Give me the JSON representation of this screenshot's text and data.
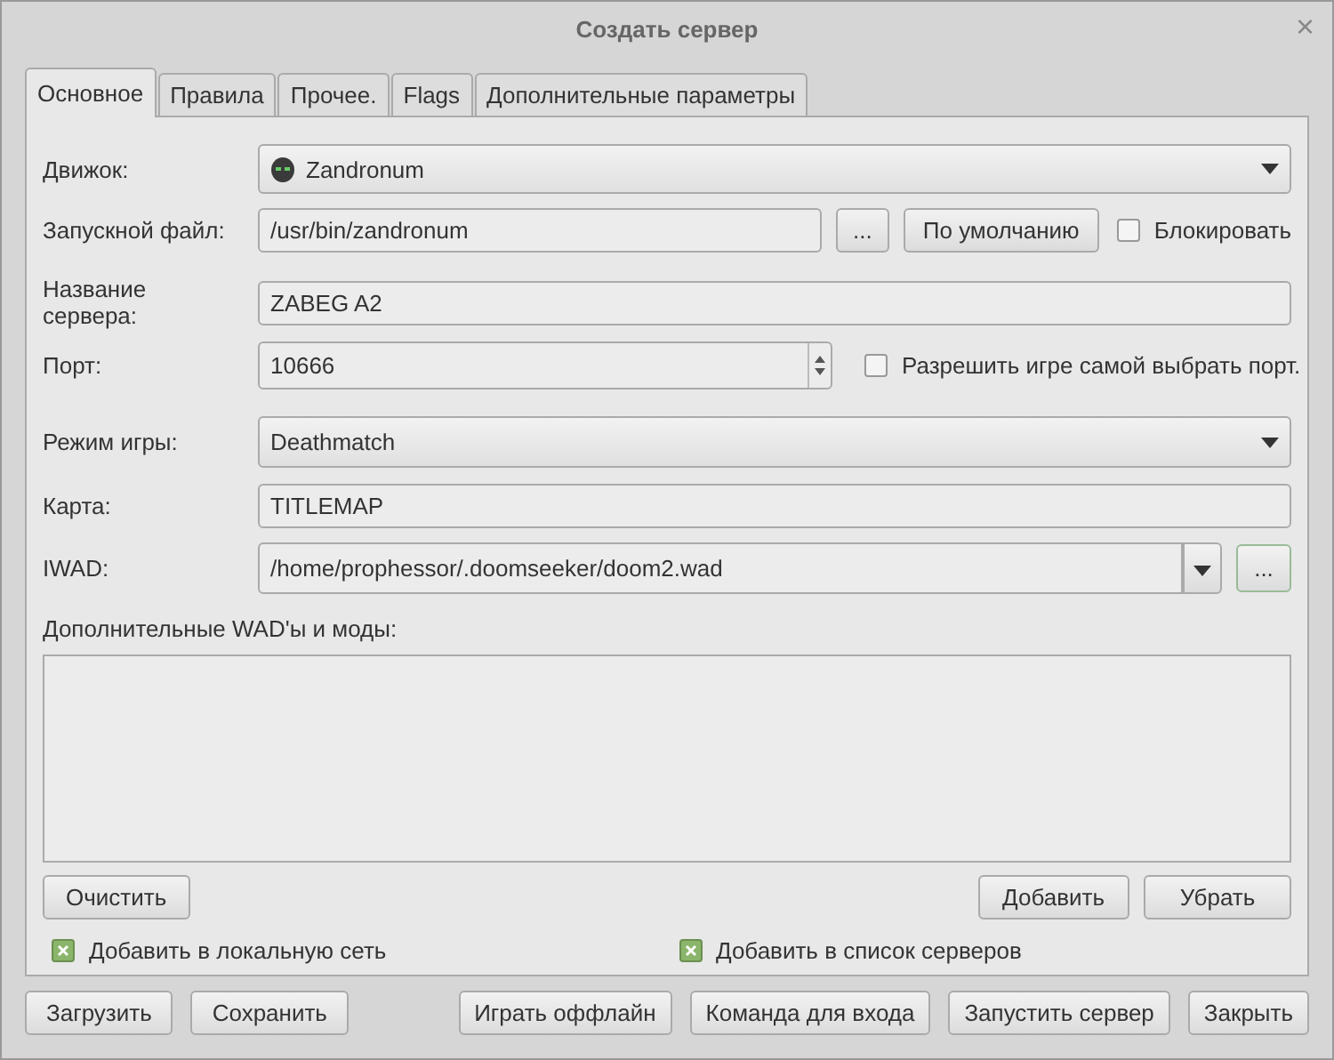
{
  "window": {
    "title": "Создать сервер",
    "close": "×"
  },
  "tabs": [
    {
      "label": "Основное",
      "selected": true
    },
    {
      "label": "Правила",
      "selected": false
    },
    {
      "label": "Прочее.",
      "selected": false
    },
    {
      "label": "Flags",
      "selected": false
    },
    {
      "label": "Дополнительные параметры",
      "selected": false
    }
  ],
  "engine": {
    "label": "Движок:",
    "value": "Zandronum"
  },
  "executable": {
    "label": "Запускной файл:",
    "value": "/usr/bin/zandronum",
    "browse": "...",
    "default_button": "По умолчанию",
    "lock": {
      "label": "Блокировать",
      "checked": false
    }
  },
  "server_name": {
    "label": "Название сервера:",
    "value": "ZABEG A2"
  },
  "port": {
    "label": "Порт:",
    "value": "10666",
    "auto": {
      "label": "Разрешить игре самой выбрать порт.",
      "checked": false
    }
  },
  "game_mode": {
    "label": "Режим игры:",
    "value": "Deathmatch"
  },
  "map": {
    "label": "Карта:",
    "value": "TITLEMAP"
  },
  "iwad": {
    "label": "IWAD:",
    "value": "/home/prophessor/.doomseeker/doom2.wad",
    "browse": "..."
  },
  "wads": {
    "label": "Дополнительные WAD'ы и моды:",
    "clear": "Очистить",
    "add": "Добавить",
    "remove": "Убрать"
  },
  "options": [
    {
      "label": "Добавить в локальную сеть",
      "checked": true
    },
    {
      "label": "Добавить в список серверов",
      "checked": true
    }
  ],
  "buttons_left": [
    "Загрузить",
    "Сохранить"
  ],
  "buttons_right": [
    "Играть оффлайн",
    "Команда для входа",
    "Запустить сервер",
    "Закрыть"
  ]
}
